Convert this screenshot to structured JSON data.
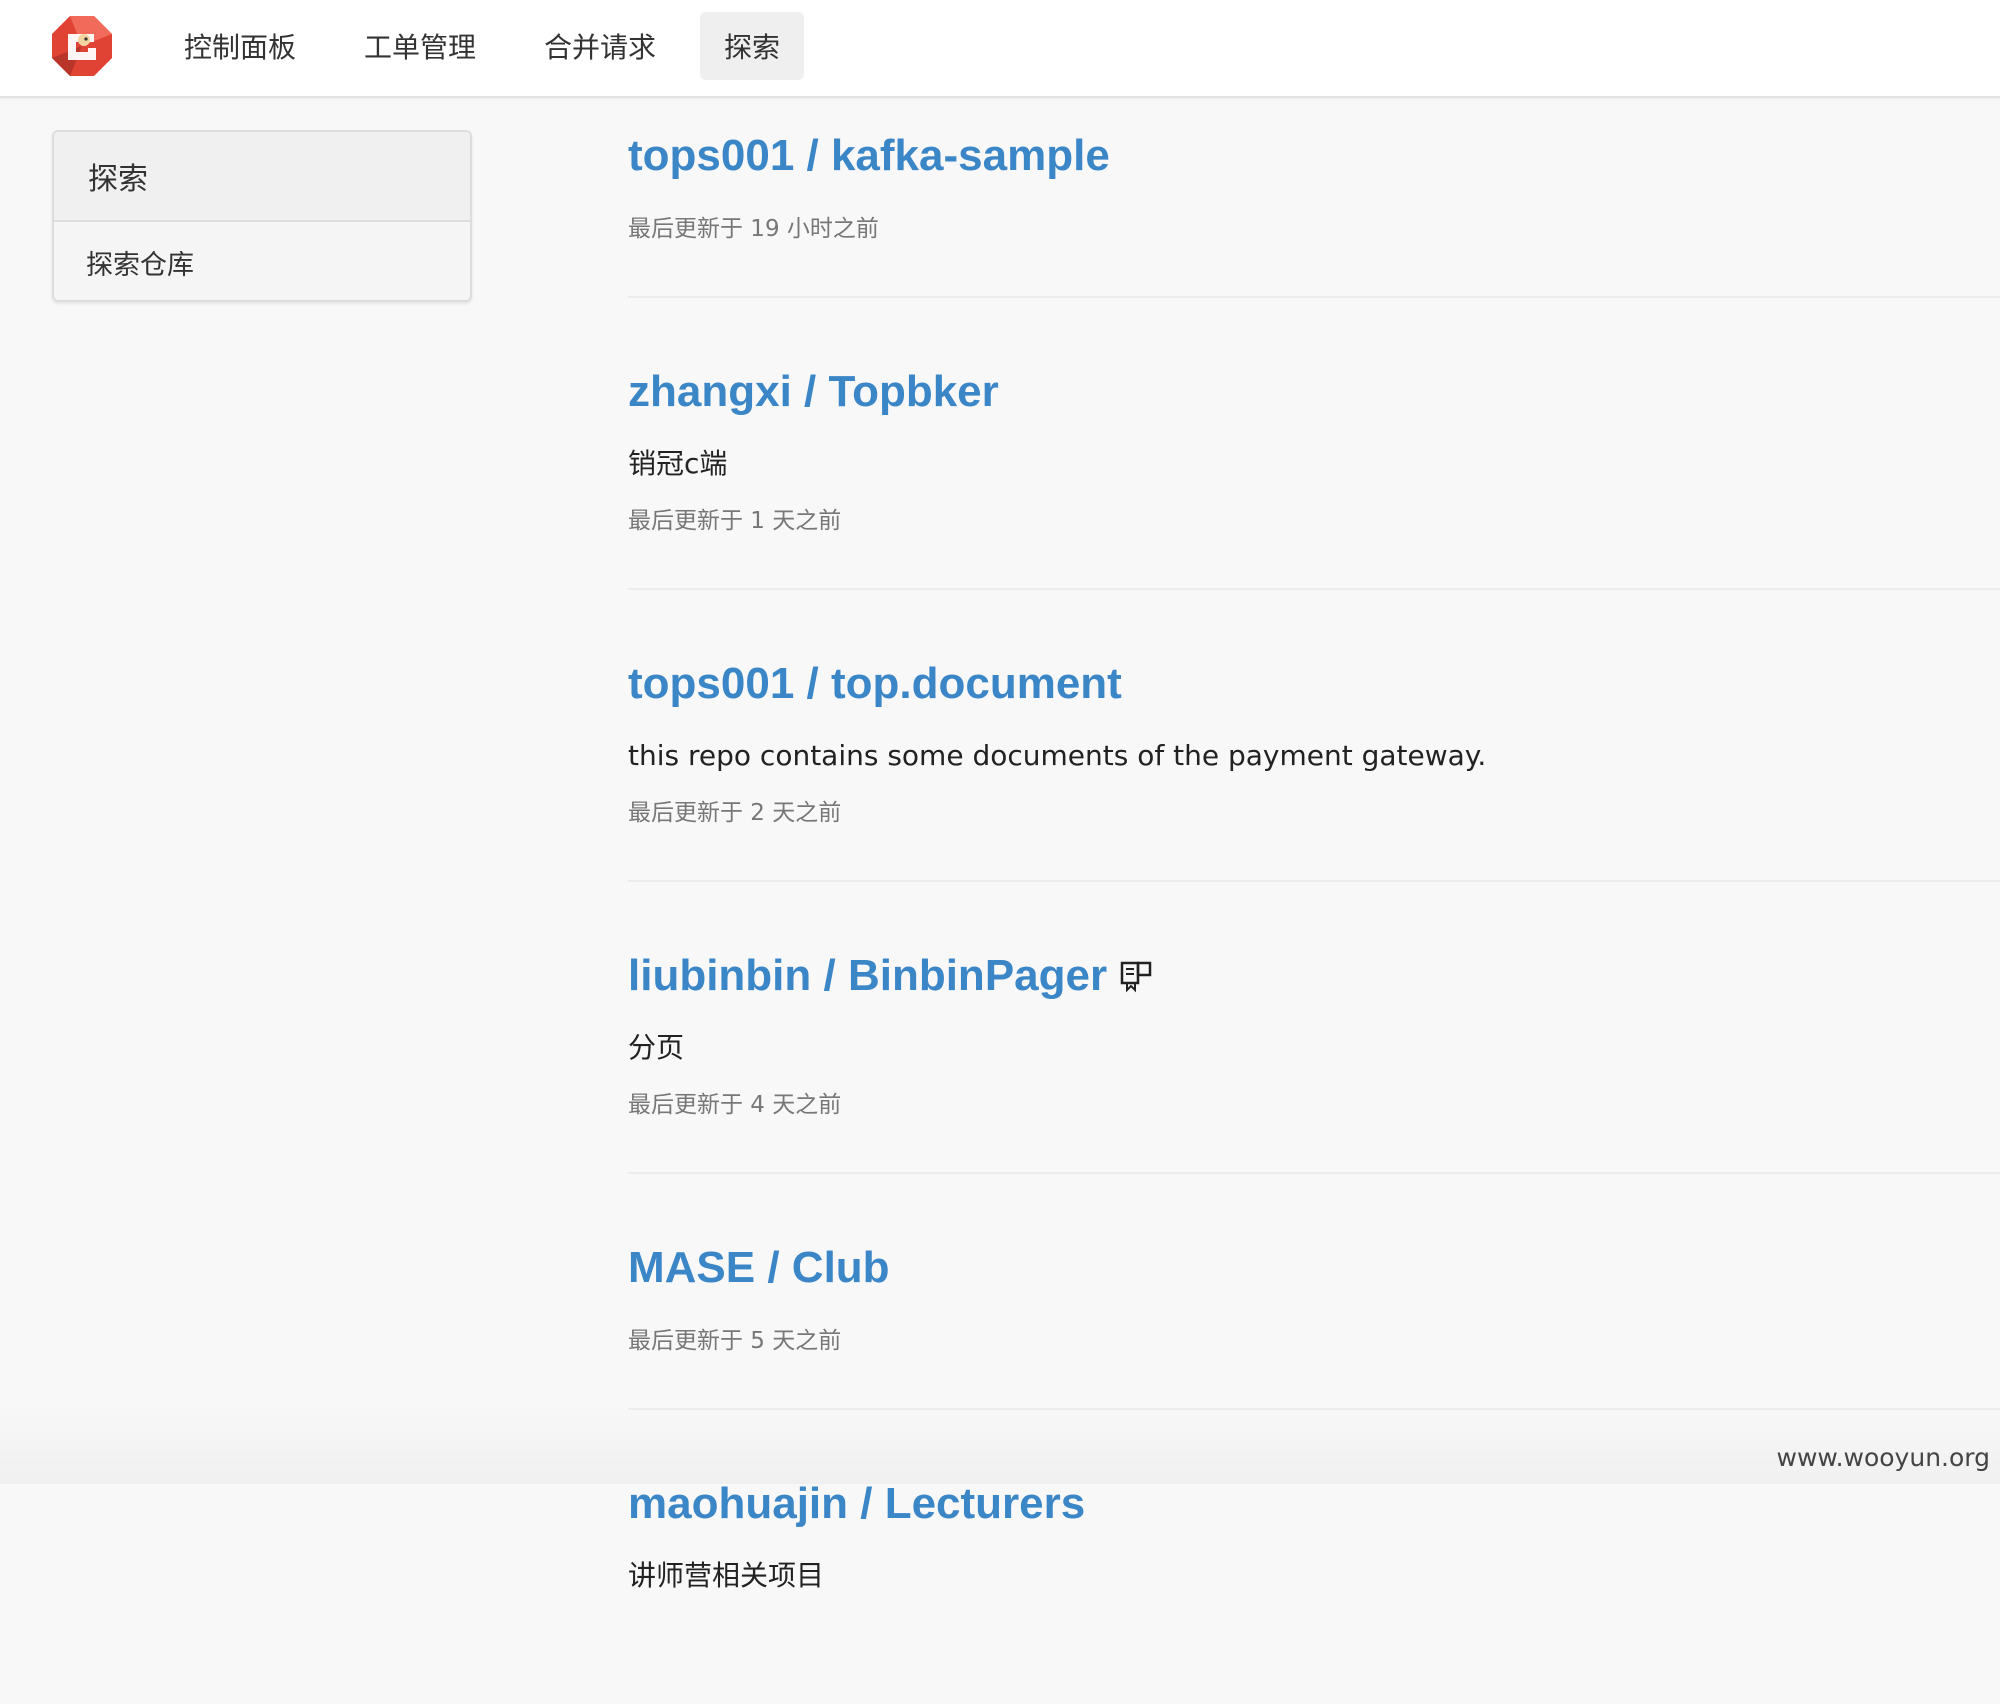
{
  "nav": {
    "items": [
      {
        "label": "控制面板"
      },
      {
        "label": "工单管理"
      },
      {
        "label": "合并请求"
      },
      {
        "label": "探索",
        "active": true
      }
    ]
  },
  "sidebar": {
    "heading": "探索",
    "items": [
      {
        "label": "探索仓库"
      }
    ]
  },
  "repos": [
    {
      "title": "tops001 / kafka-sample",
      "description": "",
      "updated": "最后更新于 19 小时之前"
    },
    {
      "title": "zhangxi / Topbker",
      "description": "销冠c端",
      "updated": "最后更新于 1 天之前"
    },
    {
      "title": "tops001 / top.document",
      "description": "this repo contains some documents of the payment gateway.",
      "updated": "最后更新于 2 天之前"
    },
    {
      "title": "liubinbin / BinbinPager",
      "description": "分页",
      "updated": "最后更新于 4 天之前",
      "icon": "mirror-icon"
    },
    {
      "title": "MASE / Club",
      "description": "",
      "updated": "最后更新于 5 天之前"
    },
    {
      "title": "maohuajin / Lecturers",
      "description": "讲师营相关项目",
      "updated": ""
    }
  ],
  "watermark": "www.wooyun.org",
  "colors": {
    "link": "#3b86c7",
    "muted": "#777777",
    "background": "#f8f8f8"
  }
}
